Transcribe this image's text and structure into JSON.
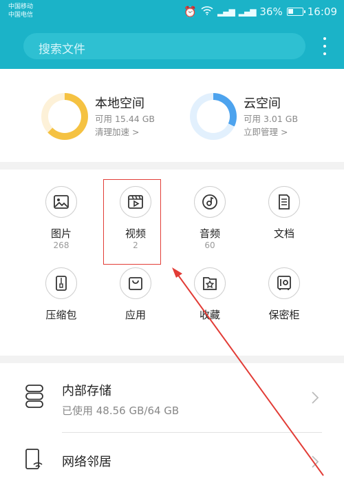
{
  "status_bar": {
    "carrier1": "中国移动",
    "carrier2": "中国电信",
    "battery": "36%",
    "time": "16:09"
  },
  "search": {
    "placeholder": "搜索文件"
  },
  "storage": {
    "local": {
      "title": "本地空间",
      "available": "可用 15.44 GB",
      "action": "清理加速 >",
      "used_fraction": 0.63
    },
    "cloud": {
      "title": "云空间",
      "available": "可用 3.01 GB",
      "action": "立即管理 >",
      "used_fraction": 0.32
    }
  },
  "categories": [
    {
      "label": "图片",
      "count": "268",
      "icon": "image-icon"
    },
    {
      "label": "视频",
      "count": "2",
      "icon": "video-icon"
    },
    {
      "label": "音频",
      "count": "60",
      "icon": "music-disc-icon"
    },
    {
      "label": "文档",
      "count": "",
      "icon": "document-icon"
    },
    {
      "label": "压缩包",
      "count": "",
      "icon": "zip-icon"
    },
    {
      "label": "应用",
      "count": "",
      "icon": "shopping-bag-icon"
    },
    {
      "label": "收藏",
      "count": "",
      "icon": "star-icon"
    },
    {
      "label": "保密柜",
      "count": "",
      "icon": "safe-icon"
    }
  ],
  "list": {
    "internal": {
      "title": "内部存储",
      "sub": "已使用 48.56 GB/64 GB"
    },
    "network": {
      "title": "网络邻居"
    }
  },
  "colors": {
    "header": "#1bb3c8",
    "local_ring": "#f5c242",
    "cloud_ring": "#4da3ee",
    "annotation": "#e23c36"
  }
}
